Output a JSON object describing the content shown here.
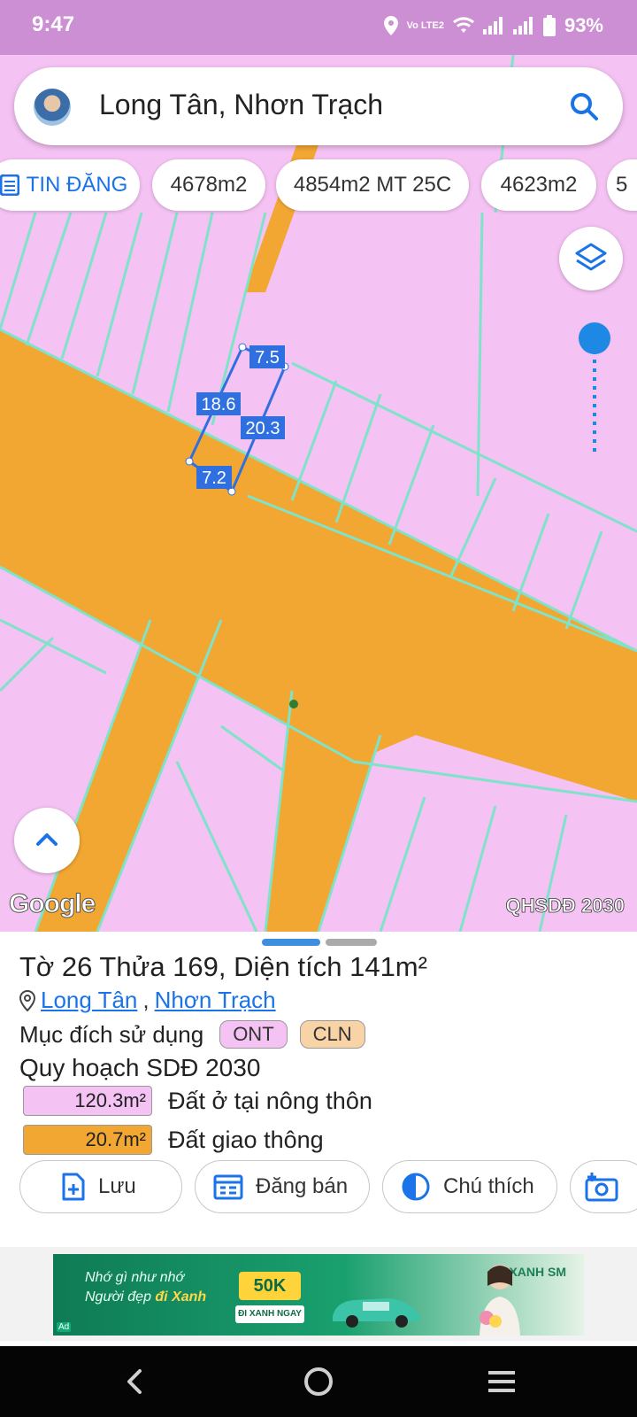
{
  "status_bar": {
    "time": "9:47",
    "network": "Vo LTE2",
    "battery": "93%"
  },
  "search": {
    "text": "Long Tân, Nhơn Trạch"
  },
  "chips": [
    {
      "label": "TIN ĐĂNG"
    },
    {
      "label": "4678m2"
    },
    {
      "label": "4854m2 MT 25C"
    },
    {
      "label": "4623m2"
    },
    {
      "label": "5"
    }
  ],
  "map": {
    "edge_labels": [
      "7.5",
      "18.6",
      "20.3",
      "7.2"
    ],
    "google_logo": "Google",
    "plan_badge": "QHSDĐ 2030",
    "colors": {
      "residential": "#f4c2f3",
      "transport": "#f2a733",
      "parcel_lines": "#7ee3c9",
      "highlight": "#2f6fe0"
    }
  },
  "sheet": {
    "title": "Tờ 26 Thửa 169, Diện tích 141m²",
    "location": {
      "commune": "Long Tân",
      "separator": ",",
      "district": "Nhơn Trạch"
    },
    "purpose_label": "Mục đích sử dụng",
    "purpose_tags": [
      {
        "code": "ONT",
        "color": "#f4c2f3"
      },
      {
        "code": "CLN",
        "color": "#f7d3a5"
      }
    ],
    "plan_title": "Quy hoạch SDĐ 2030",
    "legend": [
      {
        "area": "120.3m²",
        "label": "Đất ở tại nông thôn",
        "color": "#f4c2f3"
      },
      {
        "area": "20.7m²",
        "label": "Đất giao thông",
        "color": "#f2a733"
      }
    ],
    "actions": [
      {
        "label": "Lưu",
        "icon": "file-plus-icon"
      },
      {
        "label": "Đăng bán",
        "icon": "calendar-list-icon"
      },
      {
        "label": "Chú thích",
        "icon": "half-circle-icon"
      },
      {
        "label": "",
        "icon": "add-photo-icon"
      }
    ]
  },
  "ad": {
    "line1": "Nhớ gì như nhớ",
    "line2_pre": "Người đẹp ",
    "line2_highlight": "đi Xanh",
    "offer": "50K",
    "cta": "ĐI XANH NGAY",
    "brand": "XANH SM",
    "mark": "Ad"
  }
}
